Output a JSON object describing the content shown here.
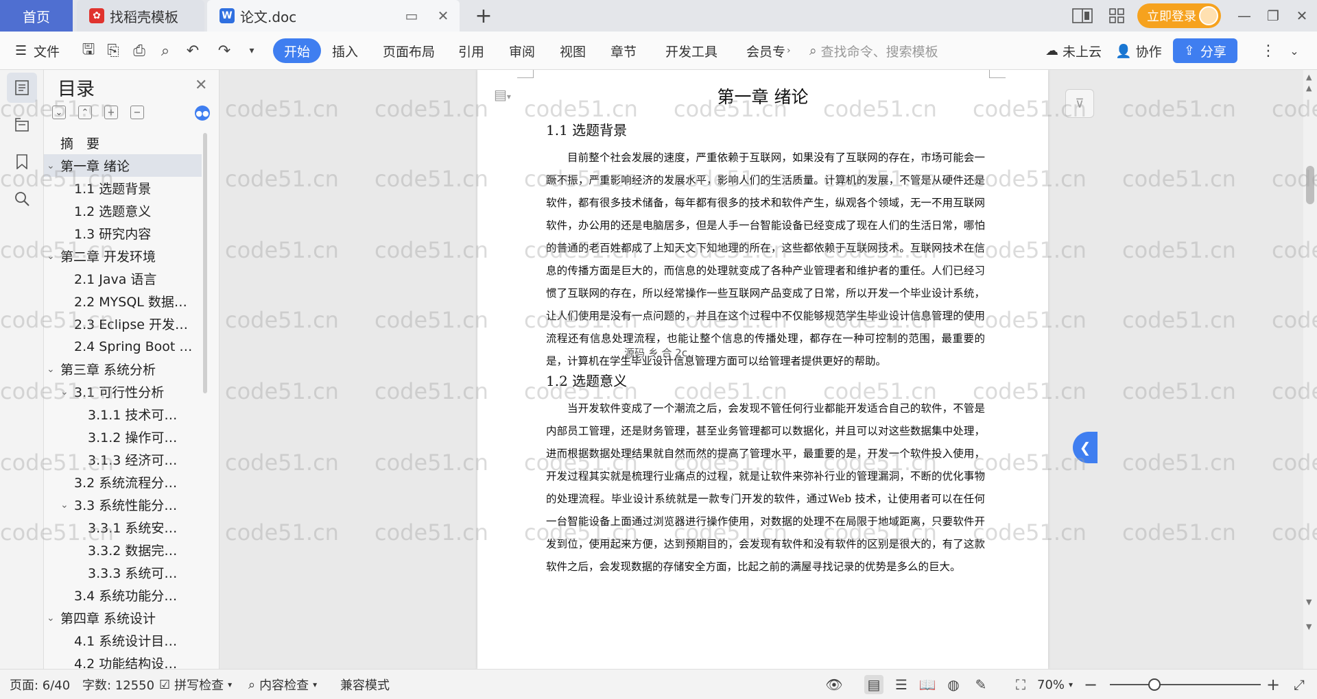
{
  "tabs": {
    "home": "首页",
    "templates": "找稻壳模板",
    "doc": "论文.doc"
  },
  "titlebar": {
    "login": "立即登录"
  },
  "ribbon": {
    "file": "文件",
    "menus": [
      "开始",
      "插入",
      "页面布局",
      "引用",
      "审阅",
      "视图",
      "章节",
      "开发工具",
      "会员专"
    ],
    "search_placeholder": "查找命令、搜索模板",
    "cloud": "未上云",
    "collab": "协作",
    "share": "分享"
  },
  "toc": {
    "title": "目录",
    "items": [
      {
        "label": "摘　要",
        "level": 1,
        "arrow": ""
      },
      {
        "label": "第一章  绪论",
        "level": 1,
        "arrow": "v",
        "selected": true
      },
      {
        "label": "1.1  选题背景",
        "level": 2,
        "arrow": ""
      },
      {
        "label": "1.2  选题意义",
        "level": 2,
        "arrow": ""
      },
      {
        "label": "1.3  研究内容",
        "level": 2,
        "arrow": ""
      },
      {
        "label": "第二章  开发环境",
        "level": 1,
        "arrow": "v"
      },
      {
        "label": "2.1 Java 语言",
        "level": 2,
        "arrow": ""
      },
      {
        "label": "2.2 MYSQL 数据…",
        "level": 2,
        "arrow": ""
      },
      {
        "label": "2.3 Eclipse 开发…",
        "level": 2,
        "arrow": ""
      },
      {
        "label": "2.4 Spring Boot …",
        "level": 2,
        "arrow": ""
      },
      {
        "label": "第三章  系统分析",
        "level": 1,
        "arrow": "v"
      },
      {
        "label": "3.1 可行性分析",
        "level": 2,
        "arrow": "v"
      },
      {
        "label": "3.1.1 技术可…",
        "level": 3,
        "arrow": ""
      },
      {
        "label": "3.1.2 操作可…",
        "level": 3,
        "arrow": ""
      },
      {
        "label": "3.1.3 经济可…",
        "level": 3,
        "arrow": ""
      },
      {
        "label": "3.2 系统流程分…",
        "level": 2,
        "arrow": ""
      },
      {
        "label": "3.3 系统性能分…",
        "level": 2,
        "arrow": "v"
      },
      {
        "label": "3.3.1 系统安…",
        "level": 3,
        "arrow": ""
      },
      {
        "label": "3.3.2 数据完…",
        "level": 3,
        "arrow": ""
      },
      {
        "label": "3.3.3 系统可…",
        "level": 3,
        "arrow": ""
      },
      {
        "label": "3.4 系统功能分…",
        "level": 2,
        "arrow": ""
      },
      {
        "label": "第四章  系统设计",
        "level": 1,
        "arrow": "v"
      },
      {
        "label": "4.1  系统设计目…",
        "level": 2,
        "arrow": ""
      },
      {
        "label": "4.2 功能结构设…",
        "level": 2,
        "arrow": ""
      }
    ]
  },
  "document": {
    "chapter_title": "第一章  绪论",
    "s1_title": "1.1  选题背景",
    "s1_text": "目前整个社会发展的速度，严重依赖于互联网，如果没有了互联网的存在，市场可能会一蹶不振，严重影响经济的发展水平，影响人们的生活质量。计算机的发展，不管是从硬件还是软件，都有很多技术储备，每年都有很多的技术和软件产生，纵观各个领域，无一不用互联网软件，办公用的还是电脑居多，但是人手一台智能设备已经变成了现在人们的生活日常，哪怕的普通的老百姓都成了上知天文下知地理的所在，这些都依赖于互联网技术。互联网技术在信息的传播方面是巨大的，而信息的处理就变成了各种产业管理者和维护者的重任。人们已经习惯了互联网的存在，所以经常操作一些互联网产品变成了日常，所以开发一个毕业设计系统，让人们使用是没有一点问题的，并且在这个过程中不仅能够规范学生毕业设计信息管理的使用流程还有信息处理流程，也能让整个信息的传播处理，都存在一种可控制的范围，最重要的是，计算机在学生毕业设计信息管理方面可以给管理者提供更好的帮助。",
    "source_note": "源码 乡 合 2c…",
    "s2_title": "1.2  选题意义",
    "s2_text": "当开发软件变成了一个潮流之后，会发现不管任何行业都能开发适合自己的软件，不管是内部员工管理，还是财务管理，甚至业务管理都可以数据化，并且可以对这些数据集中处理，进而根据数据处理结果就自然而然的提高了管理水平，最重要的是，开发一个软件投入使用，开发过程其实就是梳理行业痛点的过程，就是让软件来弥补行业的管理漏洞，不断的优化事物的处理流程。毕业设计系统就是一款专门开发的软件，通过Web 技术，让使用者可以在任何一台智能设备上面通过浏览器进行操作使用，对数据的处理不在局限于地域距离，只要软件开发到位，使用起来方便，达到预期目的，会发现有软件和没有软件的区别是很大的，有了这款软件之后，会发现数据的存储安全方面，比起之前的满屋寻找记录的优势是多么的巨大。"
  },
  "statusbar": {
    "page": "页面: 6/40",
    "words": "字数: 12550",
    "spell": "拼写检查",
    "content_check": "内容检查",
    "compat": "兼容模式",
    "zoom": "70%"
  },
  "watermark": "code51.cn",
  "colors": {
    "accent": "#3f7ef0",
    "home_tab": "#4f6fd1",
    "login": "#f6a21e"
  }
}
